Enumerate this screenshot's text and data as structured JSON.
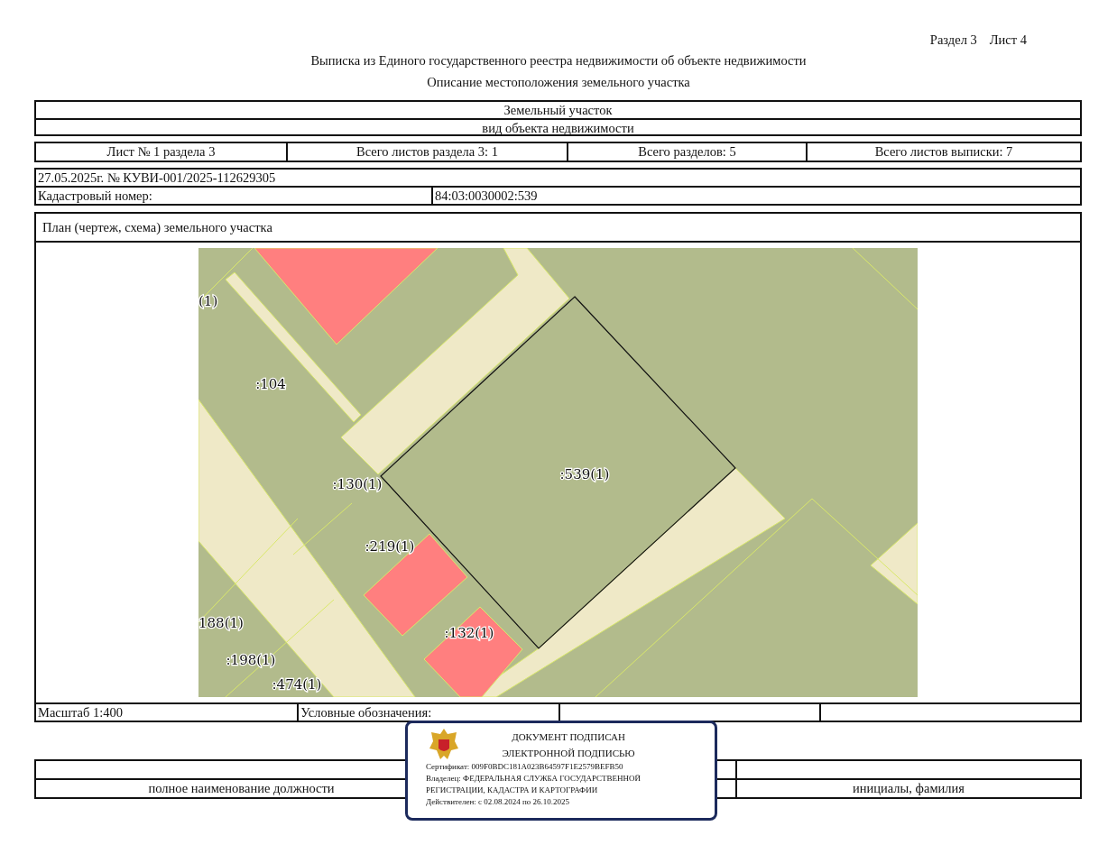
{
  "page_ref": {
    "section": "Раздел 3",
    "sheet": "Лист 4"
  },
  "title": "Выписка из Единого государственного реестра недвижимости об объекте недвижимости",
  "subtitle": "Описание местоположения земельного участка",
  "object": {
    "type": "Земельный участок",
    "caption": "вид объекта недвижимости"
  },
  "sheet_info": [
    "Лист № 1 раздела 3",
    "Всего листов раздела 3: 1",
    "Всего разделов: 5",
    "Всего листов выписки: 7"
  ],
  "statement": "27.05.2025г. № КУВИ-001/2025-112629305",
  "cadastral": {
    "label": "Кадастровый номер:",
    "value": "84:03:0030002:539"
  },
  "plan": {
    "title": "План (чертеж, схема) земельного участка",
    "labels": [
      ":104",
      "(1)",
      ":130(1)",
      ":539(1)",
      ":219(1)",
      ":132(1)",
      "188(1)",
      ":198(1)",
      ":474(1)"
    ]
  },
  "scale": "Масштаб 1:400",
  "legend_label": "Условные обозначения:",
  "signature": {
    "position_caption": "полное наименование должности",
    "name_caption": "инициалы, фамилия"
  },
  "stamp": {
    "lines": [
      "ДОКУМЕНТ ПОДПИСАН",
      "ЭЛЕКТРОННОЙ ПОДПИСЬЮ"
    ],
    "certificate": "Сертификат: 009F0BDC181A023B64597F1E2579BEFB50",
    "owner": [
      "Владелец: ФЕДЕРАЛЬНАЯ СЛУЖБА ГОСУДАРСТВЕННОЙ",
      "РЕГИСТРАЦИИ, КАДАСТРА И КАРТОГРАФИИ"
    ],
    "validity": "Действителен: с 02.08.2024 по 26.10.2025"
  }
}
